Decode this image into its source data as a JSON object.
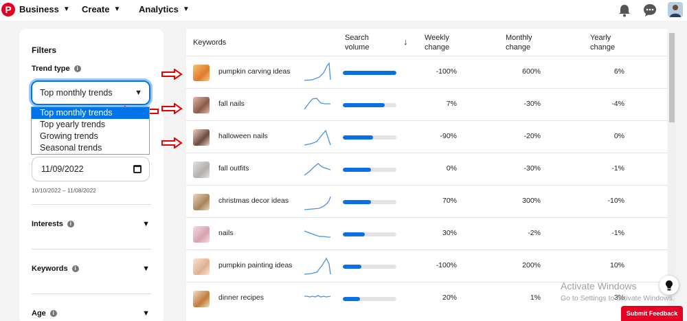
{
  "nav": {
    "logo": "P",
    "items": [
      {
        "label": "Business"
      },
      {
        "label": "Create"
      },
      {
        "label": "Analytics"
      }
    ]
  },
  "filters": {
    "title": "Filters",
    "trend_type_label": "Trend type",
    "selected_trend": "Top monthly trends",
    "dropdown_options": [
      "Top monthly trends",
      "Top yearly trends",
      "Growing trends",
      "Seasonal trends"
    ],
    "date_value": "11/09/2022",
    "date_range": "10/10/2022 – 11/08/2022",
    "sections": [
      "Interests",
      "Keywords",
      "Age"
    ]
  },
  "table": {
    "headers": {
      "keywords": "Keywords",
      "search_volume_1": "Search",
      "search_volume_2": "volume",
      "sort_arrow": "↓",
      "weekly_1": "Weekly",
      "weekly_2": "change",
      "monthly_1": "Monthly",
      "monthly_2": "change",
      "yearly_1": "Yearly",
      "yearly_2": "change"
    },
    "rows": [
      {
        "keyword": "pumpkin carving ideas",
        "volume": 1.0,
        "weekly": "-100%",
        "monthly": "600%",
        "yearly": "6%"
      },
      {
        "keyword": "fall nails",
        "volume": 0.78,
        "weekly": "7%",
        "monthly": "-30%",
        "yearly": "-4%"
      },
      {
        "keyword": "halloween nails",
        "volume": 0.56,
        "weekly": "-90%",
        "monthly": "-20%",
        "yearly": "0%"
      },
      {
        "keyword": "fall outfits",
        "volume": 0.53,
        "weekly": "0%",
        "monthly": "-30%",
        "yearly": "-1%"
      },
      {
        "keyword": "christmas decor ideas",
        "volume": 0.52,
        "weekly": "70%",
        "monthly": "300%",
        "yearly": "-10%"
      },
      {
        "keyword": "nails",
        "volume": 0.41,
        "weekly": "30%",
        "monthly": "-2%",
        "yearly": "-1%"
      },
      {
        "keyword": "pumpkin painting ideas",
        "volume": 0.35,
        "weekly": "-100%",
        "monthly": "200%",
        "yearly": "10%"
      },
      {
        "keyword": "dinner recipes",
        "volume": 0.32,
        "weekly": "20%",
        "monthly": "1%",
        "yearly": "3%"
      }
    ]
  },
  "overlay": {
    "activate_title": "Activate Windows",
    "activate_sub": "Go to Settings to activate Windows.",
    "help_icon": "lightbulb-icon",
    "feedback": "Submit Feedback"
  },
  "colors": {
    "brand": "#e60023",
    "accent": "#0b6fe0",
    "annotation_arrow": "#e60000"
  }
}
